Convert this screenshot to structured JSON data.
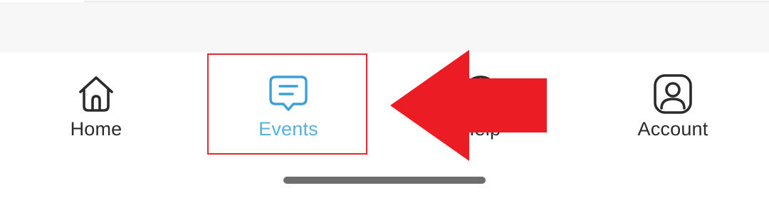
{
  "tab_bar": {
    "items": [
      {
        "label": "Home",
        "icon": "home-icon",
        "active": false
      },
      {
        "label": "Events",
        "icon": "chat-bubble-icon",
        "active": true
      },
      {
        "label": "Help",
        "icon": "help-icon",
        "active": false
      },
      {
        "label": "Account",
        "icon": "account-icon",
        "active": false
      }
    ]
  },
  "annotation": {
    "highlight_color": "#e52b2f",
    "arrow_color": "#ec1c24",
    "target": "Events"
  },
  "colors": {
    "active_tab": "#55b2e0",
    "inactive_tab": "#2b2b2b",
    "top_strip": "#f7f7f7",
    "home_indicator": "#6e6e6e"
  }
}
